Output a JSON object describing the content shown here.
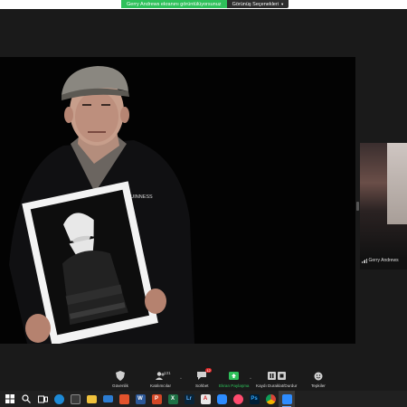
{
  "share_banner": {
    "status": "Gerry Andrews ekranını görüntülüyorsunuz",
    "view_options": "Görünüş Seçenekleri",
    "caret": "▾"
  },
  "thumbnail": {
    "name": "Gerry Andrews"
  },
  "toolbar": {
    "security": "Güvenlik",
    "participants": "Katılımcılar",
    "participants_count": "131",
    "chat": "Sohbet",
    "chat_badge": "12",
    "share_screen": "Ekran Paylaşma",
    "record": "Kaydı Duraklat/Durdur",
    "reactions": "Tepkiler",
    "caret": "^"
  },
  "shared_content": {
    "brand_text": "GUINNESS"
  },
  "colors": {
    "share_green": "#2ec05a",
    "badge_red": "#e02828",
    "toolbar_bg": "#1a1a1a",
    "taskbar_bg": "#202020"
  },
  "taskbar": {
    "icons": [
      "windows-start-icon",
      "search-icon",
      "task-view-icon",
      "edge-icon",
      "store-icon",
      "file-explorer-icon",
      "mail-icon",
      "office-icon",
      "word-icon",
      "powerpoint-icon",
      "excel-icon",
      "lightroom-icon",
      "acrobat-icon",
      "zoom-icon",
      "sketch-icon",
      "photoshop-icon",
      "chrome-icon",
      "zoom-meeting-icon"
    ]
  }
}
